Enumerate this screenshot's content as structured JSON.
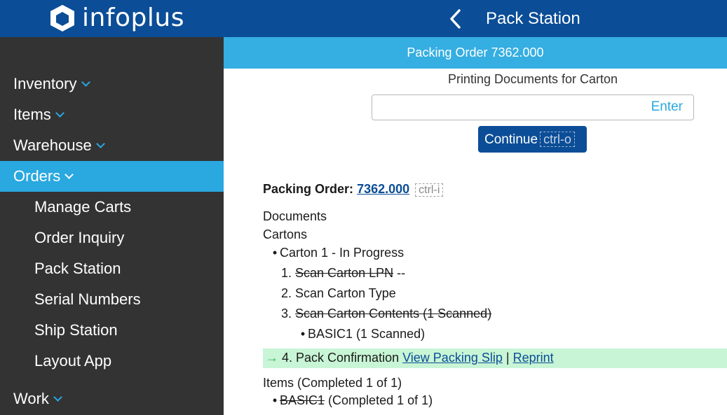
{
  "header": {
    "logo_text": "infoplus",
    "page_title": "Pack Station"
  },
  "sidebar": {
    "items": [
      {
        "label": "Inventory"
      },
      {
        "label": "Items"
      },
      {
        "label": "Warehouse"
      },
      {
        "label": "Orders"
      },
      {
        "label": "Work"
      }
    ],
    "orders_sub": [
      {
        "label": "Manage Carts"
      },
      {
        "label": "Order Inquiry"
      },
      {
        "label": "Pack Station"
      },
      {
        "label": "Serial Numbers"
      },
      {
        "label": "Ship Station"
      },
      {
        "label": "Layout App"
      }
    ]
  },
  "banner": {
    "text": "Packing Order 7362.000"
  },
  "scan": {
    "prompt": "Printing Documents for Carton",
    "input_value": "",
    "enter_hint": "Enter",
    "continue_label": "Continue",
    "continue_shortcut": "ctrl-o"
  },
  "order": {
    "label": "Packing Order:",
    "number": "7362.000",
    "shortcut": "ctrl-i",
    "documents_label": "Documents",
    "cartons_label": "Cartons",
    "carton": "Carton 1 - In Progress",
    "steps": {
      "s1_num": "1.",
      "s1_text": "Scan Carton LPN",
      "s1_suffix": "--",
      "s2_num": "2.",
      "s2_text": "Scan Carton Type",
      "s3_num": "3.",
      "s3_text": "Scan Carton Contents (1 Scanned)",
      "s3_item": "BASIC1 (1 Scanned)",
      "s4_arrow": "→",
      "s4_text": "4. Pack Confirmation",
      "s4_link1": "View Packing Slip",
      "s4_sep": "|",
      "s4_link2": "Reprint"
    },
    "items_label": "Items (Completed 1 of 1)",
    "item_sku": "BASIC1",
    "item_status": "(Completed 1 of 1)"
  },
  "colors": {
    "header_bg": "#0b4d97",
    "sidebar_bg": "#333333",
    "accent": "#2aa8e0",
    "highlight": "#c8f5d5"
  }
}
